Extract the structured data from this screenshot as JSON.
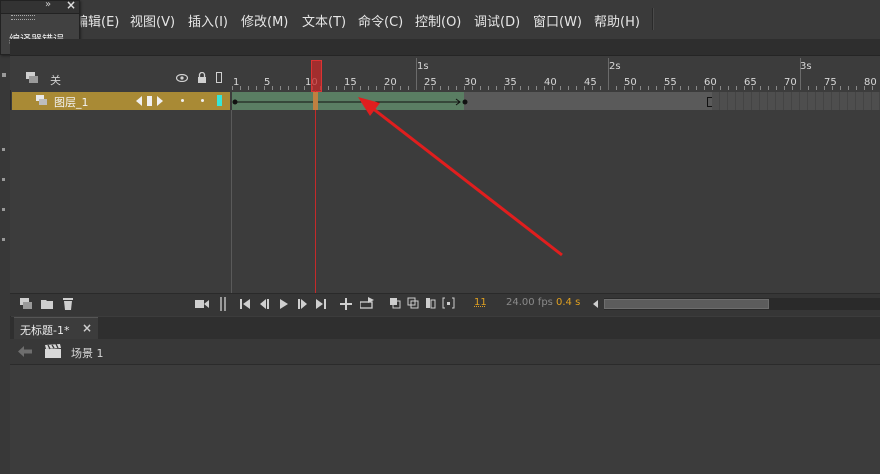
{
  "menubar": {
    "items": [
      "编辑(E)",
      "视图(V)",
      "插入(I)",
      "修改(M)",
      "文本(T)",
      "命令(C)",
      "控制(O)",
      "调试(D)",
      "窗口(W)",
      "帮助(H)"
    ]
  },
  "compiler_panel": {
    "title": "编译器错误",
    "arrows_glyph": "»",
    "close_glyph": "×"
  },
  "timeline": {
    "layers_header_label": "关",
    "layer_name": "图层_1",
    "seconds_labels": [
      "1s",
      "2s",
      "3s"
    ],
    "frame_numbers": [
      "1",
      "5",
      "10",
      "15",
      "20",
      "25",
      "30",
      "35",
      "40",
      "45",
      "50",
      "55",
      "60",
      "65",
      "70",
      "75",
      "80"
    ],
    "current_frame": "11",
    "fps": "24.00 fps",
    "time": "0.4 s",
    "colors": {
      "layer_selected": "#a98a35",
      "tween_fill": "#5a7e63",
      "playhead": "#c42a2a",
      "arrow": "#e01e1e"
    }
  },
  "document": {
    "tab_title": "无标题-1*",
    "tab_close": "×",
    "scene_label": "场景 1"
  }
}
